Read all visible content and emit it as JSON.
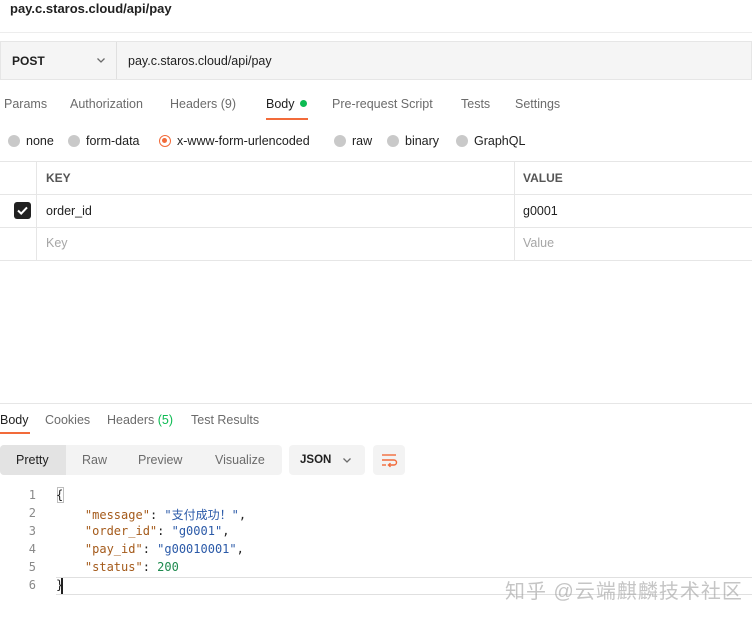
{
  "request": {
    "title": "pay.c.staros.cloud/api/pay",
    "method": "POST",
    "url": "pay.c.staros.cloud/api/pay"
  },
  "request_tabs": {
    "params": "Params",
    "authorization": "Authorization",
    "headers": "Headers",
    "headers_count": "(9)",
    "body": "Body",
    "prerequest": "Pre-request Script",
    "tests": "Tests",
    "settings": "Settings",
    "active": "Body"
  },
  "body_types": {
    "none": "none",
    "form_data": "form-data",
    "urlencoded": "x-www-form-urlencoded",
    "raw": "raw",
    "binary": "binary",
    "graphql": "GraphQL",
    "selected": "x-www-form-urlencoded"
  },
  "table": {
    "key_header": "KEY",
    "value_header": "VALUE",
    "rows": [
      {
        "checked": true,
        "key": "order_id",
        "value": "g0001"
      }
    ],
    "key_placeholder": "Key",
    "value_placeholder": "Value"
  },
  "response_tabs": {
    "body": "Body",
    "cookies": "Cookies",
    "headers": "Headers",
    "headers_count": "(5)",
    "test_results": "Test Results",
    "active": "Body"
  },
  "view_modes": {
    "pretty": "Pretty",
    "raw": "Raw",
    "preview": "Preview",
    "visualize": "Visualize",
    "active": "Pretty"
  },
  "format": "JSON",
  "code": {
    "line_numbers": [
      "1",
      "2",
      "3",
      "4",
      "5",
      "6"
    ],
    "open_brace": "{",
    "close_brace": "}",
    "message_key": "\"message\"",
    "message_value": "\"支付成功！\"",
    "order_id_key": "\"order_id\"",
    "order_id_value": "\"g0001\"",
    "pay_id_key": "\"pay_id\"",
    "pay_id_value": "\"g00010001\"",
    "status_key": "\"status\"",
    "status_value": "200"
  },
  "watermark": "知乎 @云端麒麟技术社区",
  "colors": {
    "accent": "#f26b3a",
    "success": "#0cbb52"
  }
}
